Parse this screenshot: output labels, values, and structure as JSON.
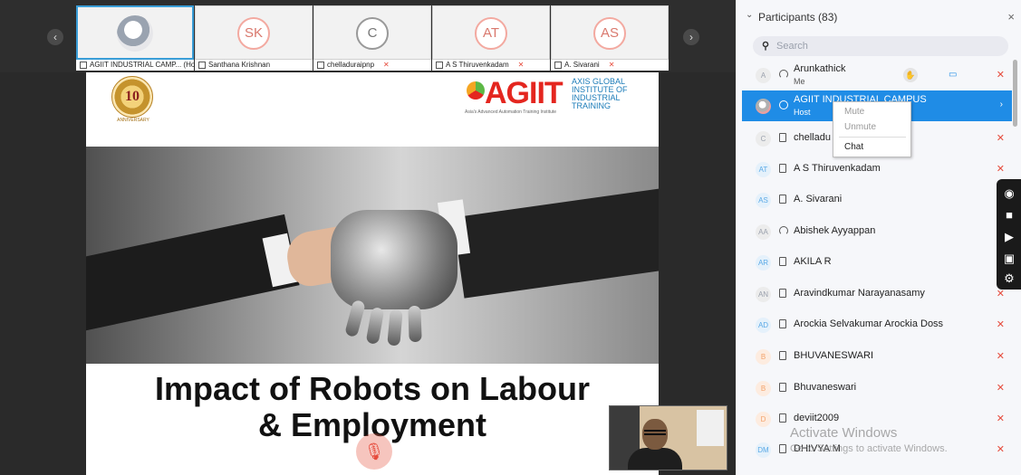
{
  "meeting": {
    "thumbnails": [
      {
        "initials": "",
        "label": "AGIIT INDUSTRIAL CAMP... (Host)",
        "active": true
      },
      {
        "initials": "SK",
        "label": "Santhana Krishnan"
      },
      {
        "initials": "C",
        "label": "chelladuraipnp"
      },
      {
        "initials": "AT",
        "label": "A S Thiruvenkadam"
      },
      {
        "initials": "AS",
        "label": "A. Sivarani"
      }
    ],
    "slide": {
      "badge_number": "10",
      "badge_sub": "ANNIVERSARY",
      "brand_word": "AGIIT",
      "brand_full": "AXIS GLOBAL\nINSTITUTE OF\nINDUSTRIAL\nTRAINING",
      "brand_tagline": "Asia's Advanced Automation Training Institute",
      "title_line1": "Impact of Robots on Labour",
      "title_line2": "& Employment"
    },
    "mute_icon": "muted-mic-icon"
  },
  "participants": {
    "header": "Participants (83)",
    "search_placeholder": "Search",
    "list": [
      {
        "initials": "A",
        "name": "Arunkathick",
        "sub": "Me"
      },
      {
        "initials": "",
        "name": "AGIIT INDUSTRIAL CAMPUS",
        "sub": "Host"
      },
      {
        "initials": "C",
        "name": "chelladu"
      },
      {
        "initials": "AT",
        "name": "A S Thiruvenkadam"
      },
      {
        "initials": "AS",
        "name": "A. Sivarani"
      },
      {
        "initials": "AA",
        "name": "Abishek Ayyappan"
      },
      {
        "initials": "AR",
        "name": "AKILA R"
      },
      {
        "initials": "AN",
        "name": "Aravindkumar Narayanasamy"
      },
      {
        "initials": "AD",
        "name": "Arockia Selvakumar Arockia Doss"
      },
      {
        "initials": "B",
        "name": "BHUVANESWARI"
      },
      {
        "initials": "B",
        "name": "Bhuvaneswari"
      },
      {
        "initials": "D",
        "name": "deviit2009"
      },
      {
        "initials": "DM",
        "name": "DHIVYA M"
      }
    ],
    "context_menu": {
      "mute": "Mute",
      "unmute": "Unmute",
      "chat": "Chat"
    }
  },
  "watermark": {
    "line1": "Activate Windows",
    "line2": "Go to Settings to activate Windows."
  },
  "colors": {
    "host_highlight": "#1f8ce6",
    "muted_mic": "#e64b3c",
    "brand_red": "#e4261f"
  }
}
